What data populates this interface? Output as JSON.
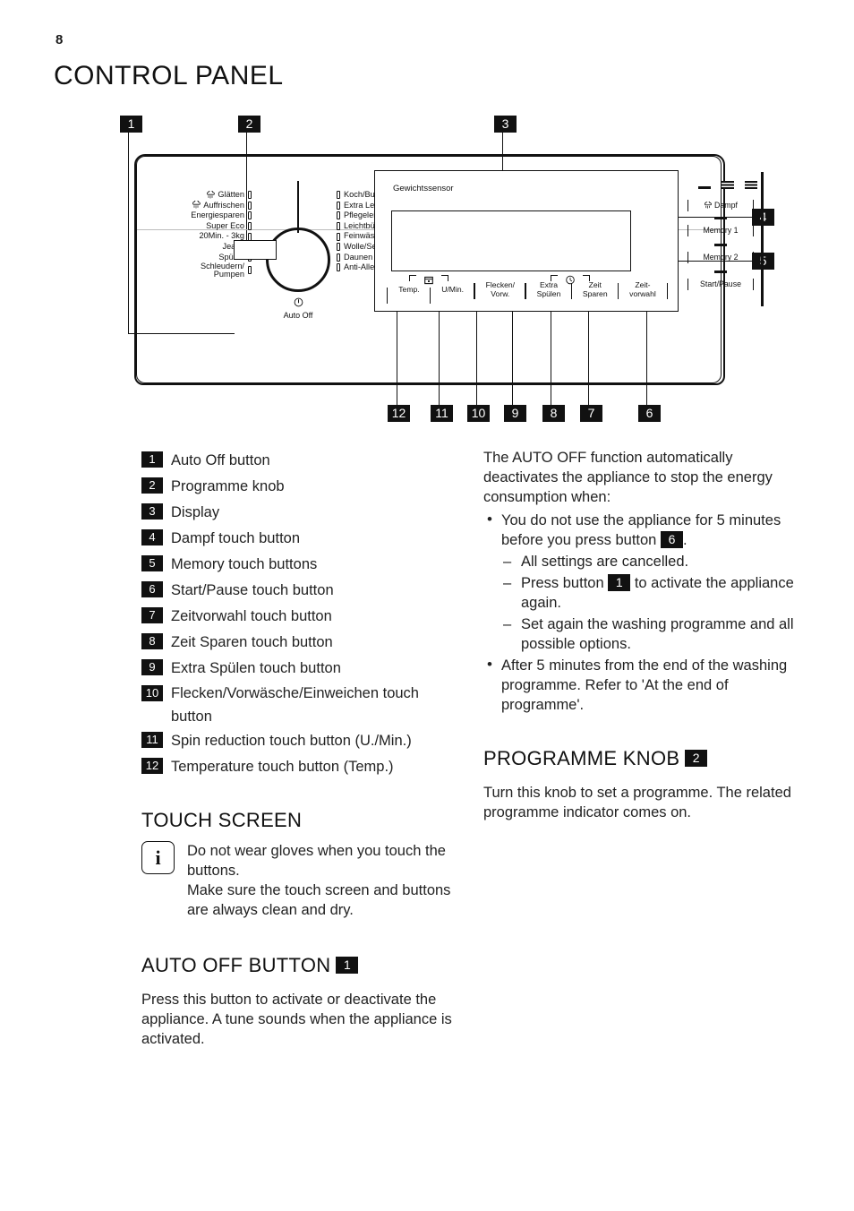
{
  "page": {
    "number": "8",
    "title": "CONTROL PANEL"
  },
  "diagram": {
    "callouts": [
      {
        "id": "1",
        "label": "1"
      },
      {
        "id": "2",
        "label": "2"
      },
      {
        "id": "3",
        "label": "3"
      },
      {
        "id": "4",
        "label": "4"
      },
      {
        "id": "5",
        "label": "5"
      },
      {
        "id": "6",
        "label": "6"
      },
      {
        "id": "7",
        "label": "7"
      },
      {
        "id": "8",
        "label": "8"
      },
      {
        "id": "9",
        "label": "9"
      },
      {
        "id": "10",
        "label": "10"
      },
      {
        "id": "11",
        "label": "11"
      },
      {
        "id": "12",
        "label": "12"
      }
    ],
    "programmes_left": [
      {
        "label": "Glätten",
        "icon": "steam-icon"
      },
      {
        "label": "Auffrischen",
        "icon": "steam-icon"
      },
      {
        "label": "Energiesparen",
        "icon": ""
      },
      {
        "label": "Super Eco",
        "icon": ""
      },
      {
        "label": "20Min. - 3kg",
        "icon": ""
      },
      {
        "label": "Jeans",
        "icon": ""
      },
      {
        "label": "Spülen",
        "icon": ""
      },
      {
        "label": "Schleudern/",
        "label2": "Pumpen",
        "icon": ""
      }
    ],
    "programmes_right": [
      {
        "label": "Koch/Bunt",
        "icon": ""
      },
      {
        "label": "Extra Leise",
        "icon": ""
      },
      {
        "label": "Pflegeleicht",
        "icon": ""
      },
      {
        "label": "Leichtbügeln",
        "icon": ""
      },
      {
        "label": "Feinwäsche",
        "icon": ""
      },
      {
        "label": "Wolle/Seide",
        "icon": "wool-icon"
      },
      {
        "label": "Daunen",
        "icon": ""
      },
      {
        "label": "Anti-Allergie",
        "icon": ""
      }
    ],
    "knob": {
      "auto_off_label": "Auto Off",
      "power_icon": "power-icon"
    },
    "touchscreen": {
      "weight_sensor_label": "Gewichtssensor",
      "options": [
        {
          "line1": "Temp.",
          "line2": ""
        },
        {
          "line1": "U/Min.",
          "line2": ""
        },
        {
          "line1": "Flecken/",
          "line2": "Vorw."
        },
        {
          "line1": "Extra",
          "line2": "Spülen"
        },
        {
          "line1": "Zeit",
          "line2": "Sparen"
        },
        {
          "line1": "Zeit-",
          "line2": "vorwahl"
        }
      ]
    },
    "right_buttons": [
      {
        "label": "Dampf",
        "icon": "steam-icon"
      },
      {
        "label": "Memory 1",
        "icon": ""
      },
      {
        "label": "Memory 2",
        "icon": ""
      },
      {
        "label": "Start/Pause",
        "icon": ""
      }
    ]
  },
  "legend": [
    {
      "num": "1",
      "text": "Auto Off button"
    },
    {
      "num": "2",
      "text": "Programme knob"
    },
    {
      "num": "3",
      "text": "Display"
    },
    {
      "num": "4",
      "text": "Dampf touch button"
    },
    {
      "num": "5",
      "text": "Memory touch buttons"
    },
    {
      "num": "6",
      "text": "Start/Pause touch button"
    },
    {
      "num": "7",
      "text": "Zeitvorwahl touch button"
    },
    {
      "num": "8",
      "text": "Zeit Sparen touch button"
    },
    {
      "num": "9",
      "text": "Extra Spülen touch button"
    },
    {
      "num": "10",
      "text": "Flecken/Vorwäsche/Einweichen touch button"
    },
    {
      "num": "11",
      "text": "Spin reduction touch button (U./Min.)"
    },
    {
      "num": "12",
      "text": "Temperature touch button (Temp.)"
    }
  ],
  "touch_screen_section": {
    "heading": "TOUCH SCREEN",
    "info_icon": "i",
    "body_line1": "Do not wear gloves when you touch the buttons.",
    "body_line2": "Make sure the touch screen and buttons are always clean and dry."
  },
  "auto_off_section": {
    "heading": "AUTO OFF BUTTON",
    "heading_badge": "1",
    "body": "Press this button to activate or deactivate the appliance. A tune sounds when the appliance is activated."
  },
  "auto_off_right": {
    "intro": "The AUTO OFF function automatically deactivates the appliance to stop the energy consumption when:",
    "bullet1_a": "You do not use the appliance for 5 minutes before you press button",
    "bullet1_badge": "6",
    "bullet1_b": ".",
    "sub1": "All settings are cancelled.",
    "sub2_a": "Press button",
    "sub2_badge": "1",
    "sub2_b": "to activate the appliance again.",
    "sub3": "Set again the washing programme and all possible options.",
    "bullet2": "After 5 minutes from the end of the washing programme. Refer to 'At the end of programme'."
  },
  "programme_knob_section": {
    "heading": "PROGRAMME KNOB",
    "heading_badge": "2",
    "body": "Turn this knob to set a programme. The related programme indicator comes on."
  }
}
